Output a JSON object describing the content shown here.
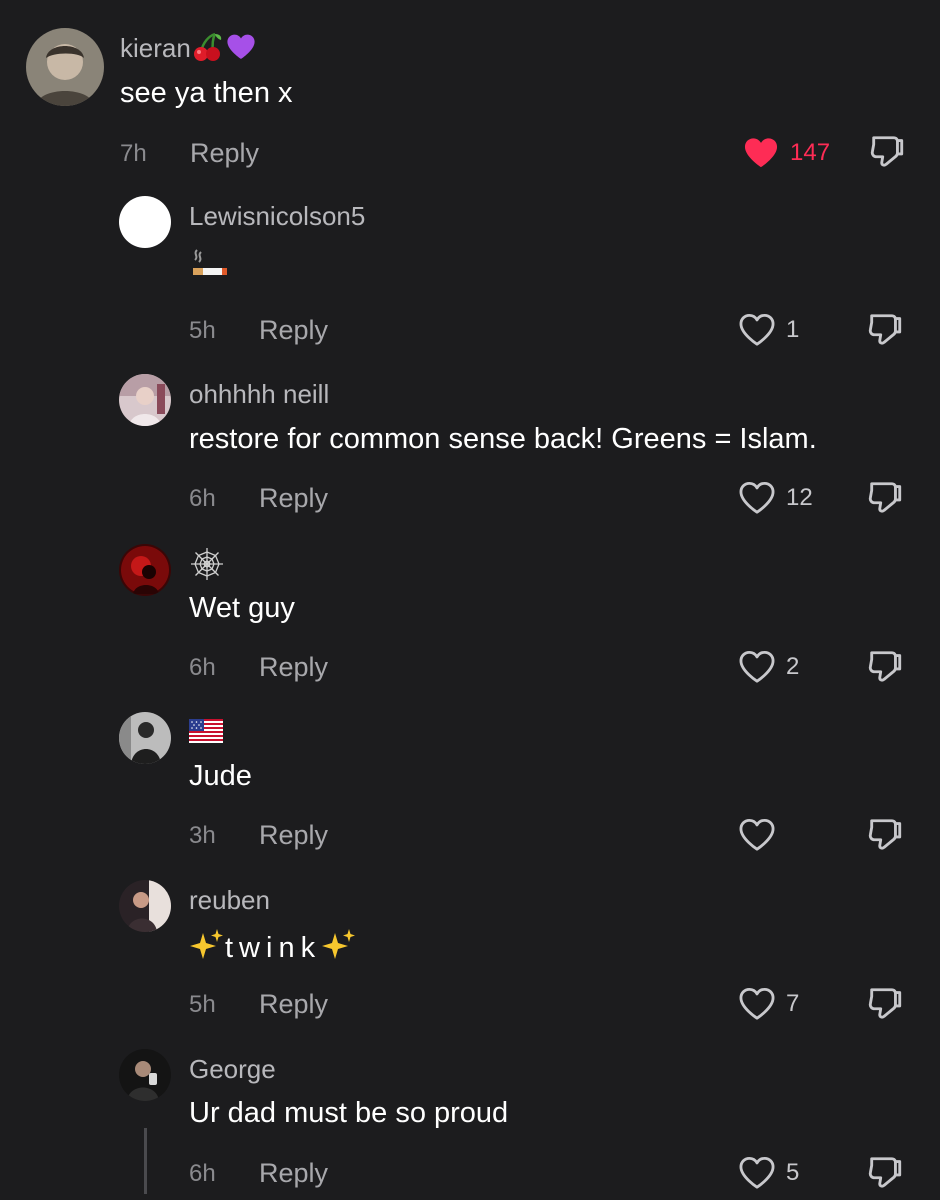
{
  "comments": [
    {
      "username": "kieran",
      "username_emoji": [
        "cherries-icon",
        "purple-heart-icon"
      ],
      "text": "see ya then x",
      "time": "7h",
      "reply_label": "Reply",
      "likes": "147",
      "liked": true
    },
    {
      "username": "Lewisnicolson5",
      "text_emoji": "cigarette-icon",
      "time": "5h",
      "reply_label": "Reply",
      "likes": "1",
      "liked": false
    },
    {
      "username": "ohhhhh neill",
      "text": "restore for common sense back! Greens = Islam.",
      "time": "6h",
      "reply_label": "Reply",
      "likes": "12",
      "liked": false
    },
    {
      "username_emoji": [
        "spider-web-icon"
      ],
      "text": "Wet guy",
      "time": "6h",
      "reply_label": "Reply",
      "likes": "2",
      "liked": false
    },
    {
      "username_emoji": [
        "us-flag-icon"
      ],
      "text": "Jude",
      "time": "3h",
      "reply_label": "Reply",
      "likes": "",
      "liked": false
    },
    {
      "username": "reuben",
      "text": "twink",
      "text_emoji": "sparkles-icon",
      "time": "5h",
      "reply_label": "Reply",
      "likes": "7",
      "liked": false
    },
    {
      "username": "George",
      "text": "Ur dad must be so proud",
      "time": "6h",
      "reply_label": "Reply",
      "likes": "5",
      "liked": false
    }
  ],
  "colors": {
    "background": "#1c1c1e",
    "liked_heart": "#fe2c55",
    "username": "#b8b8bc",
    "meta": "#8a8a8e"
  }
}
